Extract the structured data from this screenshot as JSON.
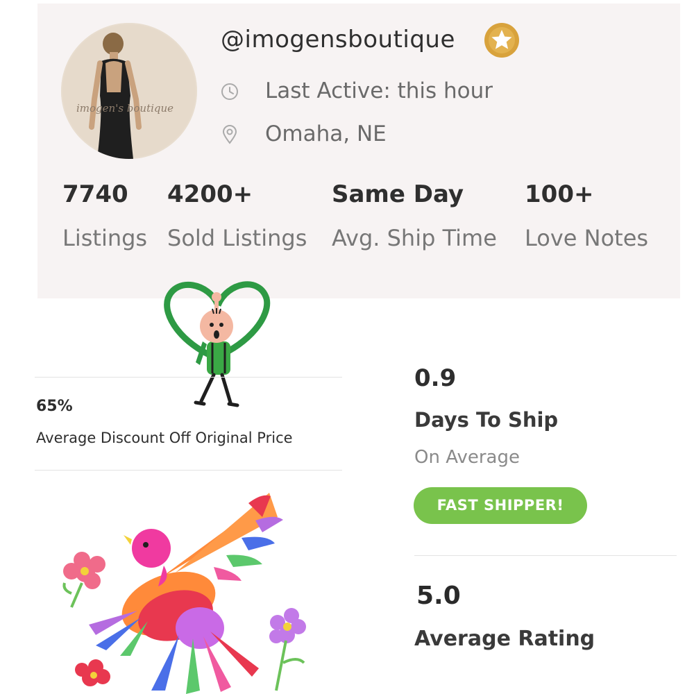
{
  "profile": {
    "handle": "@imogensboutique",
    "avatar_watermark": "imogen's boutique",
    "last_active": "Last Active: this hour",
    "location": "Omaha, NE"
  },
  "stats": [
    {
      "value": "7740",
      "label": "Listings"
    },
    {
      "value": "4200+",
      "label": "Sold Listings"
    },
    {
      "value": "Same Day",
      "label": "Avg. Ship Time"
    },
    {
      "value": "100+",
      "label": "Love Notes"
    }
  ],
  "discount": {
    "value": "65%",
    "label": "Average Discount Off Original Price"
  },
  "shipping": {
    "value": "0.9",
    "label": "Days To Ship",
    "sublabel": "On Average",
    "badge": "FAST SHIPPER!"
  },
  "rating": {
    "value": "5.0",
    "label": "Average Rating"
  },
  "icons": {
    "badge": "gold-star-badge-icon",
    "last_active": "clock-icon",
    "location": "location-pin-icon"
  },
  "colors": {
    "accent_green": "#79c34c",
    "badge_gold": "#d8a23c",
    "card_background": "#f7f3f3"
  }
}
